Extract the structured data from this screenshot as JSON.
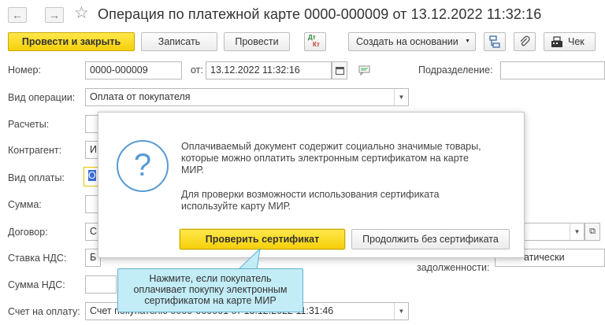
{
  "window": {
    "back_glyph": "←",
    "forward_glyph": "→",
    "star_glyph": "☆",
    "title": "Операция по платежной карте 0000-000009 от 13.12.2022 11:32:16"
  },
  "toolbar": {
    "post_close_label": "Провести и закрыть",
    "save_label": "Записать",
    "post_label": "Провести",
    "dtkt_dt": "Дт",
    "dtkt_kt": "Кт",
    "create_based_label": "Создать на основании",
    "check_label": "Чек",
    "icons": [
      "dt-kt-icon",
      "structure-icon",
      "paperclip-icon",
      "cash-register-icon"
    ]
  },
  "form": {
    "number_label": "Номер:",
    "number_value": "0000-000009",
    "from_label": "от:",
    "date_value": "13.12.2022 11:32:16",
    "subdivision_label": "Подразделение:",
    "op_type_label": "Вид операции:",
    "op_type_value": "Оплата от покупателя",
    "settlements_label": "Расчеты:",
    "counterparty_label": "Контрагент:",
    "counterparty_partial": "И",
    "payment_type_label": "Вид оплаты:",
    "payment_type_partial": "О",
    "amount_label": "Сумма:",
    "contract_label": "Договор:",
    "contract_partial": "С",
    "vat_rate_label": "Ставка НДС:",
    "vat_rate_partial": "Б",
    "vat_amount_label": "Сумма НДС:",
    "auto_partial": "атически",
    "debt_label": "задолженности:",
    "invoice_label": "Счет на оплату:",
    "invoice_value": "Счет покупателю 0000-000001 от 13.12.2022 11:31:46"
  },
  "dialog": {
    "message_line1": "Оплачиваемый документ содержит социально значимые товары,",
    "message_line2": "которые можно оплатить электронным сертификатом на карте",
    "message_line3": "МИР.",
    "message2_line1": "Для проверки возможности использования сертификата",
    "message2_line2": "используйте карту МИР.",
    "check_cert_label": "Проверить сертификат",
    "continue_label": "Продолжить без сертификата",
    "question_glyph": "?"
  },
  "tooltip": {
    "line1": "Нажмите, если покупатель",
    "line2": "оплачивает покупку электронным",
    "line3": "сертификатом на карте МИР"
  },
  "colors": {
    "primary_button": "#f5cf0a",
    "dialog_icon": "#5a9ad3",
    "tooltip_bg": "#c2ecf6",
    "tooltip_border": "#63b1d2"
  }
}
